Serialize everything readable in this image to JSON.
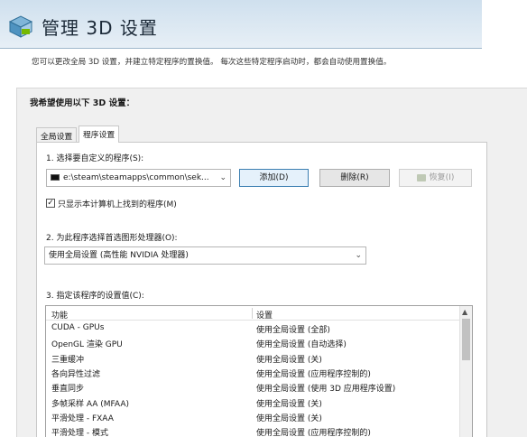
{
  "header": {
    "title": "管理 3D 设置",
    "description": "您可以更改全局 3D 设置，并建立特定程序的置换值。 每次这些特定程序启动时，都会自动使用置换值。"
  },
  "panel": {
    "title": "我希望使用以下 3D 设置："
  },
  "tabs": [
    {
      "label": "全局设置"
    },
    {
      "label": "程序设置"
    }
  ],
  "section1": {
    "label": "1. 选择要自定义的程序(S):",
    "program_path": "e:\\steam\\steamapps\\common\\sek...",
    "add_label": "添加(D)",
    "remove_label": "删除(R)",
    "restore_label": "恢复(I)",
    "show_only_label": "只显示本计算机上找到的程序(M)",
    "show_only_checked": true
  },
  "section2": {
    "label": "2. 为此程序选择首选图形处理器(O):",
    "selected": "使用全局设置 (高性能 NVIDIA 处理器)"
  },
  "section3": {
    "label": "3. 指定该程序的设置值(C):",
    "columns": [
      "功能",
      "设置"
    ],
    "rows": [
      {
        "feature": "CUDA - GPUs",
        "setting": "使用全局设置 (全部)"
      },
      {
        "feature": "OpenGL 渲染 GPU",
        "setting": "使用全局设置 (自动选择)"
      },
      {
        "feature": "三重缓冲",
        "setting": "使用全局设置 (关)"
      },
      {
        "feature": "各向异性过滤",
        "setting": "使用全局设置 (应用程序控制的)"
      },
      {
        "feature": "垂直同步",
        "setting": "使用全局设置 (使用 3D 应用程序设置)"
      },
      {
        "feature": "多帧采样 AA (MFAA)",
        "setting": "使用全局设置 (关)"
      },
      {
        "feature": "平滑处理 - FXAA",
        "setting": "使用全局设置 (关)"
      },
      {
        "feature": "平滑处理 - 模式",
        "setting": "使用全局设置 (应用程序控制的)"
      }
    ]
  },
  "colors": {
    "header_band": "#cfe0ee",
    "accent_border": "#3c7fb1"
  }
}
